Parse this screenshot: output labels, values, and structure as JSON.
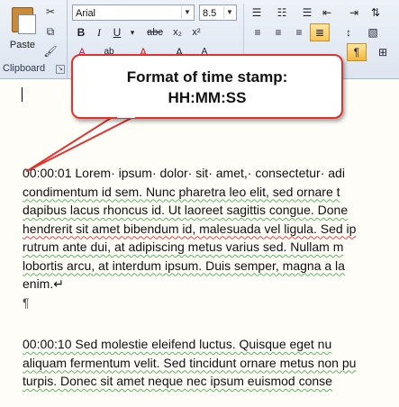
{
  "ribbon": {
    "clipboard": {
      "paste_label": "Paste",
      "group_label": "Clipboard"
    },
    "font": {
      "name": "Arial",
      "size": "8.5"
    },
    "icons": [
      "cut-icon",
      "copy-icon",
      "format-painter-icon",
      "bold-icon",
      "italic-icon",
      "underline-icon",
      "strikethrough-icon",
      "subscript-icon",
      "superscript-icon",
      "highlight-icon",
      "font-color-icon",
      "bullets-icon",
      "numbering-icon",
      "align-left-icon",
      "align-center-icon",
      "align-right-icon",
      "justify-icon",
      "show-formatting-icon"
    ],
    "buttons": {
      "bold": "B",
      "italic": "I",
      "underline": "U",
      "strike": "abc",
      "subscript": "x₂",
      "superscript": "x²",
      "show_marks": "¶"
    },
    "accent_color": "#f8c556"
  },
  "callout": {
    "title": "Format of time stamp:",
    "body": "HH:MM:SS",
    "border_color": "#e3322b"
  },
  "document": {
    "paragraph1": {
      "lines": [
        "00:00:01 Lorem· ipsum· dolor· sit· amet,· consectetur· adi",
        "condimentum id sem. Nunc pharetra leo elit, sed ornare t",
        "dapibus lacus rhoncus id. Ut laoreet sagittis congue. Done",
        "hendrerit sit amet bibendum id, malesuada vel ligula. Sed ip",
        "rutrum ante dui, at adipiscing metus varius sed. Nullam m",
        "lobortis arcu, at interdum ipsum. Duis semper, magna a la",
        "enim.↵"
      ]
    },
    "pilcrow1": "¶",
    "paragraph2": {
      "lines": [
        "00:00:10 Sed molestie eleifend luctus. Quisque eget nu",
        "aliquam fermentum velit. Sed tincidunt ornare metus non pu",
        "turpis. Donec sit amet neque nec ipsum euismod conse"
      ]
    }
  }
}
